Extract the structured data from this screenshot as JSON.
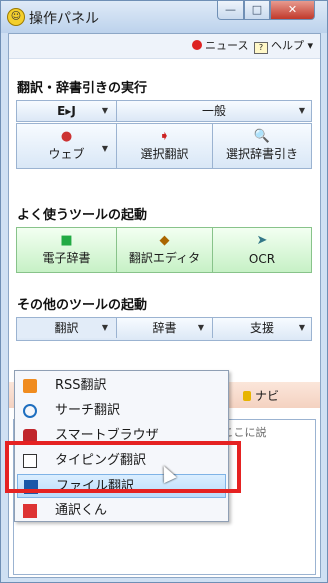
{
  "window": {
    "title": "操作パネル",
    "app_icon": "logo-face-icon"
  },
  "menu": {
    "news": "ニュース",
    "help": "ヘルプ"
  },
  "translate_section": {
    "heading": "翻訳・辞書引きの実行",
    "lang_pair": "E▸J",
    "mode": "一般",
    "tools": [
      {
        "label": "ウェブ",
        "icon": "web-icon"
      },
      {
        "label": "選択翻訳",
        "icon": "select-translate-icon"
      },
      {
        "label": "選択辞書引き",
        "icon": "dictionary-lookup-icon"
      }
    ]
  },
  "common_tools": {
    "heading": "よく使うツールの起動",
    "tools": [
      {
        "label": "電子辞書",
        "icon": "ebook-icon"
      },
      {
        "label": "翻訳エディタ",
        "icon": "editor-icon"
      },
      {
        "label": "OCR",
        "icon": "ocr-icon"
      }
    ]
  },
  "other_tools": {
    "heading": "その他のツールの起動",
    "tabs": [
      "翻訳",
      "辞書",
      "支援"
    ]
  },
  "navi": {
    "label": "ナビ",
    "text": "へ ここに説"
  },
  "dropdown": {
    "items": [
      {
        "label": "RSS翻訳",
        "icon": "rss-icon"
      },
      {
        "label": "サーチ翻訳",
        "icon": "search-icon"
      },
      {
        "label": "スマートブラウザ",
        "icon": "browser-icon"
      },
      {
        "label": "タイピング翻訳",
        "icon": "typing-icon"
      },
      {
        "label": "ファイル翻訳",
        "icon": "file-translate-icon",
        "selected": true
      },
      {
        "label": "通訳くん",
        "icon": "interpreter-icon"
      }
    ]
  },
  "colors": {
    "highlight": "#e52222",
    "accent": "#b9dcfb"
  }
}
